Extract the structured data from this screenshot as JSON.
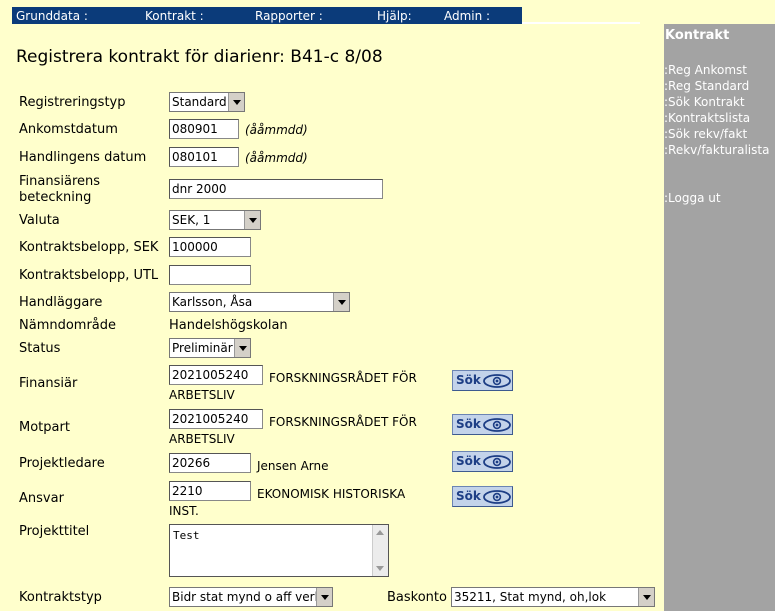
{
  "topnav": {
    "grunddata": "Grunddata :",
    "kontrakt": "Kontrakt :",
    "rapporter": "Rapporter :",
    "hjalp": "Hjälp:",
    "admin": "Admin :"
  },
  "sidebar": {
    "title": "Kontrakt",
    "items": [
      ":Reg Ankomst",
      ":Reg Standard",
      ":Sök Kontrakt",
      ":Kontraktslista",
      ":Sök rekv/fakt",
      ":Rekv/fakturalista"
    ],
    "logout": ":Logga ut"
  },
  "page": {
    "title": "Registrera kontrakt för diarienr: B41-c 8/08"
  },
  "form": {
    "registreringstyp": {
      "label": "Registreringstyp",
      "value": "Standard"
    },
    "ankomstdatum": {
      "label": "Ankomstdatum",
      "value": "080901",
      "hint": "(ååmmdd)"
    },
    "handlingens_datum": {
      "label": "Handlingens datum",
      "value": "080101",
      "hint": "(ååmmdd)"
    },
    "finansiarens_beteckning": {
      "label1": "Finansiärens",
      "label2": "beteckning",
      "value": "dnr 2000"
    },
    "valuta": {
      "label": "Valuta",
      "value": "SEK, 1"
    },
    "kontraktsbelopp_sek": {
      "label": "Kontraktsbelopp, SEK",
      "value": "100000"
    },
    "kontraktsbelopp_utl": {
      "label": "Kontraktsbelopp, UTL",
      "value": ""
    },
    "handlaggare": {
      "label": "Handläggare",
      "value": "Karlsson, Åsa"
    },
    "namndomrade": {
      "label": "Nämndområde",
      "value": "Handelshögskolan"
    },
    "status": {
      "label": "Status",
      "value": "Preliminär"
    },
    "finansiar": {
      "label": "Finansiär",
      "code": "2021005240",
      "name1": "FORSKNINGSRÅDET FÖR",
      "name2": "ARBETSLIV",
      "button": "Sök"
    },
    "motpart": {
      "label": "Motpart",
      "code": "2021005240",
      "name1": "FORSKNINGSRÅDET FÖR",
      "name2": "ARBETSLIV",
      "button": "Sök"
    },
    "projektledare": {
      "label": "Projektledare",
      "code": "20266",
      "name": "Jensen Arne",
      "button": "Sök"
    },
    "ansvar": {
      "label": "Ansvar",
      "code": "2210",
      "name1": "EKONOMISK HISTORISKA",
      "name2": "INST.",
      "button": "Sök"
    },
    "projekttitel": {
      "label": "Projekttitel",
      "value": "Test"
    },
    "kontraktstyp": {
      "label": "Kontraktstyp",
      "value": "Bidr stat mynd o aff verk"
    },
    "baskonto": {
      "label": "Baskonto",
      "value": "35211, Stat mynd, oh,lok"
    }
  },
  "colors": {
    "background": "#ffffcc",
    "nav": "#0b3b7a",
    "sidebar": "#a3a3a3",
    "button": "#c3d3ea"
  },
  "icons": {
    "search_button_icon": "eye-icon"
  }
}
